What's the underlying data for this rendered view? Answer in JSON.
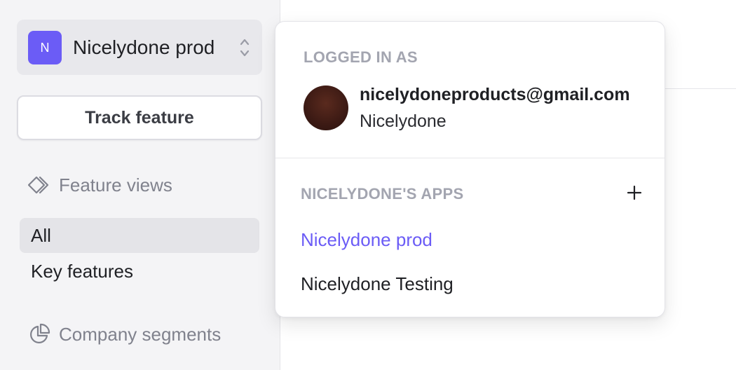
{
  "sidebar": {
    "app_switcher": {
      "initial": "N",
      "name": "Nicelydone prod",
      "accent": "#6b5cf6"
    },
    "track_button": "Track feature",
    "feature_views": {
      "heading": "Feature views",
      "icon": "diamond-arrow-icon",
      "items": [
        {
          "label": "All",
          "active": true
        },
        {
          "label": "Key features",
          "active": false
        }
      ]
    },
    "company_segments": {
      "heading": "Company segments",
      "icon": "pie-chart-icon"
    }
  },
  "dropdown": {
    "logged_in_label": "LOGGED IN AS",
    "user": {
      "email": "nicelydoneproducts@gmail.com",
      "name": "Nicelydone"
    },
    "apps_label": "NICELYDONE'S APPS",
    "add_icon": "plus-icon",
    "apps": [
      {
        "name": "Nicelydone prod",
        "current": true
      },
      {
        "name": "Nicelydone Testing",
        "current": false
      }
    ]
  }
}
